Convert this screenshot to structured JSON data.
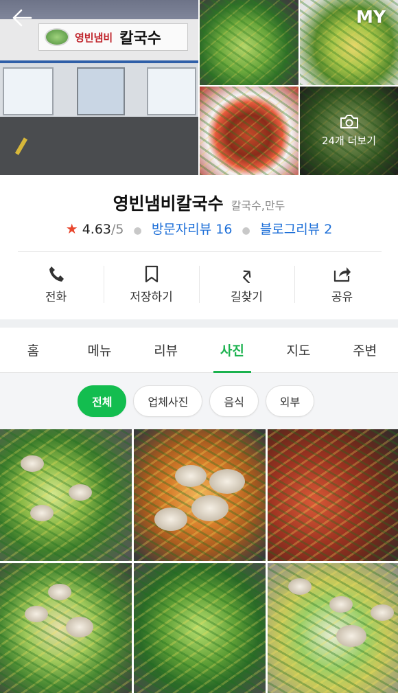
{
  "header": {
    "back_icon": "arrow-left-icon",
    "my_label": "MY",
    "more_photos_label": "24개 더보기",
    "more_photos_icon": "camera-icon"
  },
  "hero": {
    "sign_name": "영빈냄비",
    "sign_big": "칼국수"
  },
  "place": {
    "name": "영빈냄비칼국수",
    "category": "칼국수,만두",
    "rating": "4.63",
    "rating_max": "/5",
    "visitor_reviews": "방문자리뷰 16",
    "blog_reviews": "블로그리뷰 2"
  },
  "actions": [
    {
      "label": "전화",
      "icon": "phone-icon"
    },
    {
      "label": "저장하기",
      "icon": "bookmark-icon"
    },
    {
      "label": "길찾기",
      "icon": "directions-icon"
    },
    {
      "label": "공유",
      "icon": "share-icon"
    }
  ],
  "tabs": [
    {
      "label": "홈",
      "active": false
    },
    {
      "label": "메뉴",
      "active": false
    },
    {
      "label": "리뷰",
      "active": false
    },
    {
      "label": "사진",
      "active": true
    },
    {
      "label": "지도",
      "active": false
    },
    {
      "label": "주변",
      "active": false
    }
  ],
  "filters": [
    {
      "label": "전체",
      "active": true
    },
    {
      "label": "업체사진",
      "active": false
    },
    {
      "label": "음식",
      "active": false
    },
    {
      "label": "외부",
      "active": false
    }
  ],
  "colors": {
    "accent_green": "#13bd4f",
    "link_blue": "#1d6fd8",
    "star_red": "#e8452c"
  }
}
